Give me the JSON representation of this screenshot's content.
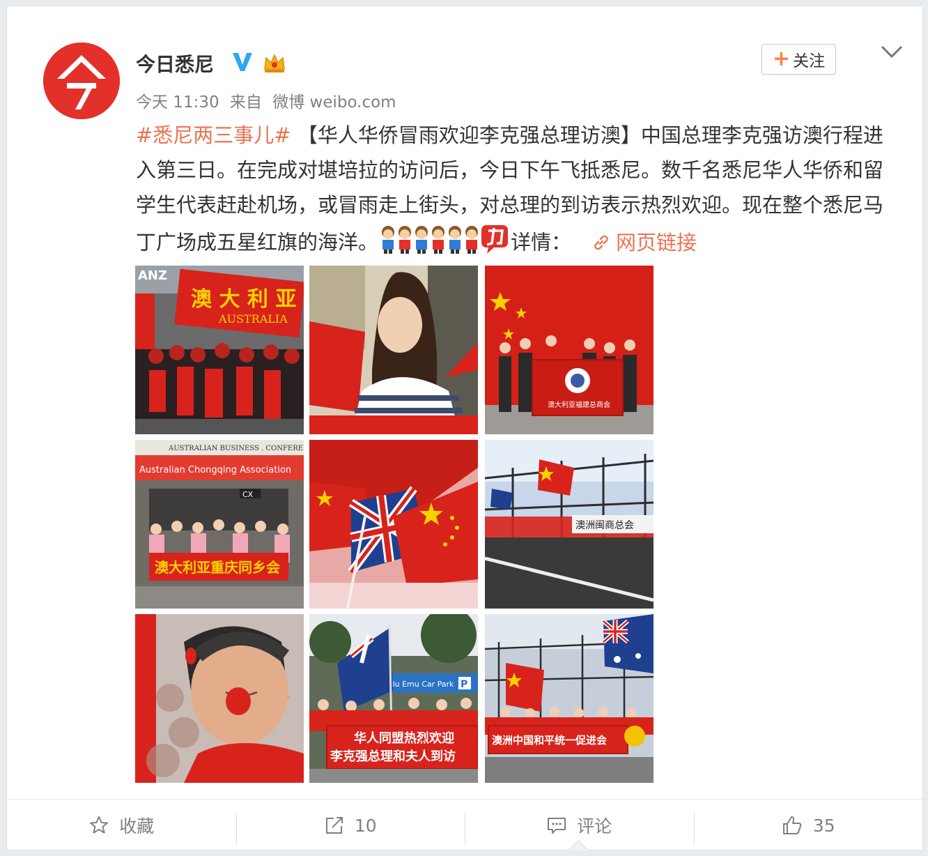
{
  "account": {
    "name": "今日悉尼",
    "avatar_glyph": "今",
    "brand_color": "#e3302a"
  },
  "meta": {
    "time": "今天 11:30",
    "from_label": "来自",
    "source": "微博 weibo.com"
  },
  "follow_button": {
    "label": "关注",
    "plus": "+"
  },
  "post": {
    "hashtag": "#悉尼两三事儿#",
    "text": " 【华人华侨冒雨欢迎李克强总理访澳】中国总理李克强访澳行程进入第三日。在完成对堪培拉的访问后，今日下午飞抵悉尼。数千名悉尼华人华侨和留学生代表赶赴机场，或冒雨走上街头，对总理的到访表示热烈欢迎。现在整个悉尼马丁广场成五星红旗的海洋。",
    "details_label": "详情：",
    "link_label": "网页链接",
    "accent_color": "#eb7350"
  },
  "photos": [
    {
      "caption_text": "澳大利亚 AUSTRALIA"
    },
    {
      "caption_text": ""
    },
    {
      "caption_text": "澳大利亚福建总商会"
    },
    {
      "caption_text": "澳大利亚重庆同乡会"
    },
    {
      "caption_text": ""
    },
    {
      "caption_text": "澳洲闽商总会"
    },
    {
      "caption_text": ""
    },
    {
      "caption_text": "华人同盟热烈欢迎 李克强总理和夫人到访"
    },
    {
      "caption_text": "澳洲中国和平统一促进会"
    }
  ],
  "photo_signs": {
    "p1_top": "澳 大 利 亚",
    "p1_en": "AUSTRALIA",
    "p1_corner": "ANZ",
    "p4_top": "AUSTRALIAN BUSINESS . CONFERENCE",
    "p4_sub": "Australian Chongqing Association",
    "p4_banner": "澳大利亚重庆同乡会",
    "p4_cx": "CX",
    "p6_banner": "澳洲闽商总会",
    "p8_sign": "Blu Emu Car Park",
    "p8_p": "P",
    "p8_banner1": "华人同盟热烈欢迎",
    "p8_banner2": "李克强总理和夫人到访",
    "p9_banner": "澳洲中国和平统一促进会"
  },
  "actions": [
    {
      "icon": "star-icon",
      "label": "收藏"
    },
    {
      "icon": "share-icon",
      "label": "10"
    },
    {
      "icon": "comment-icon",
      "label": "评论"
    },
    {
      "icon": "like-icon",
      "label": "35"
    }
  ]
}
